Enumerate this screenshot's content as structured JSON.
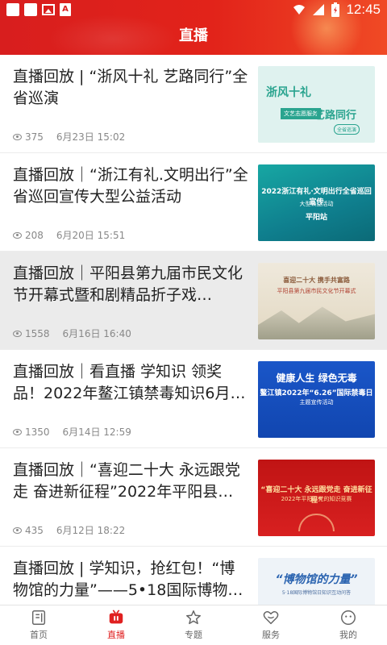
{
  "status_bar": {
    "time": "12:45"
  },
  "header": {
    "title": "直播"
  },
  "items": [
    {
      "title": "直播回放 | “浙风十礼 艺路同行”全省巡演",
      "views": "375",
      "date": "6月23日 15:02",
      "thumb": {
        "a": "浙风十礼",
        "b": "文艺志愿服务",
        "c": "艺路同行",
        "d": "全省巡演"
      }
    },
    {
      "title": "直播回放｜“浙江有礼.文明出行”全省巡回宣传大型公益活动",
      "views": "208",
      "date": "6月20日 15:51",
      "thumb": {
        "a": "2022浙江有礼·文明出行全省巡回宣传",
        "b": "大型公益活动",
        "c": "平阳站"
      }
    },
    {
      "title": "直播回放｜平阳县第九届市民文化节开幕式暨和剧精品折子戏…",
      "views": "1558",
      "date": "6月16日 16:40",
      "thumb": {
        "a": "喜迎二十大 携手共富路",
        "b": "平阳县第九届市民文化节开幕式"
      }
    },
    {
      "title": "直播回放｜看直播 学知识 领奖品！2022年鳌江镇禁毒知识6月…",
      "views": "1350",
      "date": "6月14日 12:59",
      "thumb": {
        "a": "健康人生 绿色无毒",
        "b": "鳌江镇2022年“6.26”国际禁毒日",
        "c": "主题宣传活动"
      }
    },
    {
      "title": "直播回放｜“喜迎二十大 永远跟党走 奋进新征程”2022年平阳县…",
      "views": "435",
      "date": "6月12日 18:22",
      "thumb": {
        "a": "“喜迎二十大 永远跟党走 奋进新征程”",
        "b": "2022年平阳县党的知识竞赛"
      }
    },
    {
      "title": "直播回放 | 学知识，抢红包！“博物馆的力量”——5•18国际博物…",
      "views": "",
      "date": "",
      "thumb": {
        "a": "“博物馆的力量”",
        "b": "5·18国际博物馆日知识互动问答"
      }
    }
  ],
  "tabs": [
    {
      "label": "首页",
      "icon": "home-icon"
    },
    {
      "label": "直播",
      "icon": "live-tv-icon"
    },
    {
      "label": "专题",
      "icon": "star-icon"
    },
    {
      "label": "服务",
      "icon": "heart-service-icon"
    },
    {
      "label": "我的",
      "icon": "profile-icon"
    }
  ],
  "colors": {
    "accent": "#e02020",
    "header_red": "#d81e1e"
  }
}
